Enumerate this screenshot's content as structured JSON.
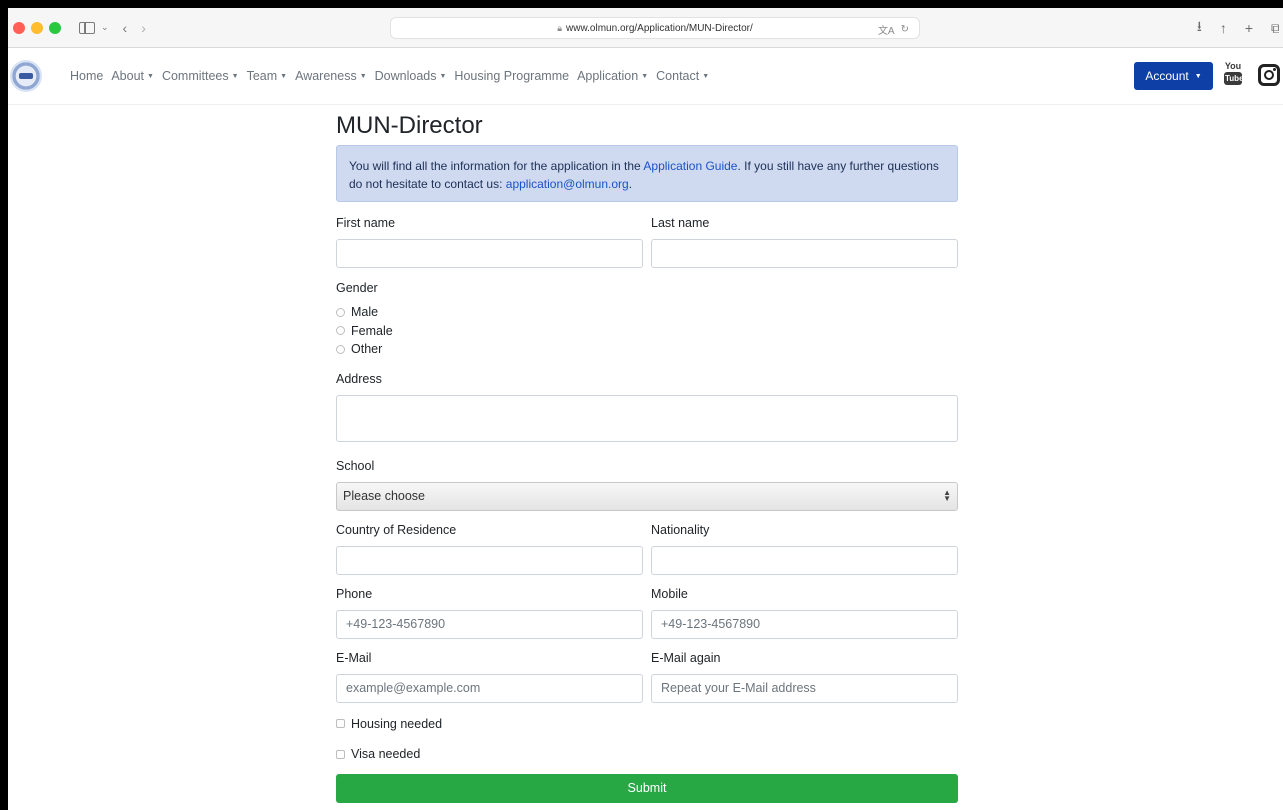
{
  "browser": {
    "url": "www.olmun.org/Application/MUN-Director/"
  },
  "nav": {
    "items": [
      {
        "label": "Home",
        "dropdown": false
      },
      {
        "label": "About",
        "dropdown": true
      },
      {
        "label": "Committees",
        "dropdown": true
      },
      {
        "label": "Team",
        "dropdown": true
      },
      {
        "label": "Awareness",
        "dropdown": true
      },
      {
        "label": "Downloads",
        "dropdown": true
      },
      {
        "label": "Housing Programme",
        "dropdown": false
      },
      {
        "label": "Application",
        "dropdown": true
      },
      {
        "label": "Contact",
        "dropdown": true
      }
    ],
    "account_label": "Account",
    "youtube_top": "You",
    "youtube_bottom": "Tube"
  },
  "page": {
    "title": "MUN-Director",
    "info": {
      "text_before_link": "You will find all the information for the application in the ",
      "guide_link": "Application Guide",
      "text_after_link": ". If you still have any further questions do not hesitate to contact us: ",
      "email_link": "application@olmun.org",
      "text_end": "."
    }
  },
  "form": {
    "first_name_label": "First name",
    "last_name_label": "Last name",
    "gender_label": "Gender",
    "gender_options": [
      "Male",
      "Female",
      "Other"
    ],
    "address_label": "Address",
    "school_label": "School",
    "school_selected": "Please choose",
    "country_label": "Country of Residence",
    "nationality_label": "Nationality",
    "phone_label": "Phone",
    "phone_placeholder": "+49-123-4567890",
    "mobile_label": "Mobile",
    "mobile_placeholder": "+49-123-4567890",
    "email_label": "E-Mail",
    "email_placeholder": "example@example.com",
    "email_again_label": "E-Mail again",
    "email_again_placeholder": "Repeat your E-Mail address",
    "housing_label": "Housing needed",
    "visa_label": "Visa needed",
    "submit_label": "Submit"
  },
  "colors": {
    "account_button": "#0d3fa6",
    "submit_button": "#28a745",
    "info_background": "#cfdaf0",
    "link": "#1a53c7"
  }
}
